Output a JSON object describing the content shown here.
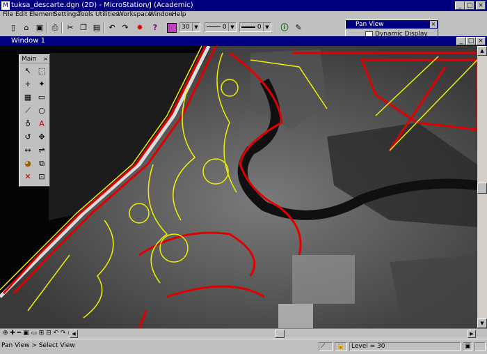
{
  "app": {
    "title": "tuksa_descarte.dgn (2D) - MicroStation/J (Academic)",
    "window_title": "Window 1"
  },
  "menu": [
    "File",
    "Edit",
    "Element",
    "Settings",
    "Tools",
    "Utilities",
    "Workspace",
    "Window",
    "Help"
  ],
  "toolbar": {
    "level_value": "30",
    "line_style_value": "0",
    "line_weight_value": "0",
    "color_swatch": "#c040c0"
  },
  "pan_view": {
    "title": "Pan View",
    "checkbox_label": "Dynamic Display",
    "checked": false
  },
  "palette": {
    "title": "Main"
  },
  "status": {
    "left": "Pan View > Select View",
    "level": "Level = 30"
  },
  "colors": {
    "title_bar": "#000080",
    "chrome": "#c0c0c0",
    "vector_red": "#e00000",
    "vector_yellow": "#f0f000"
  }
}
